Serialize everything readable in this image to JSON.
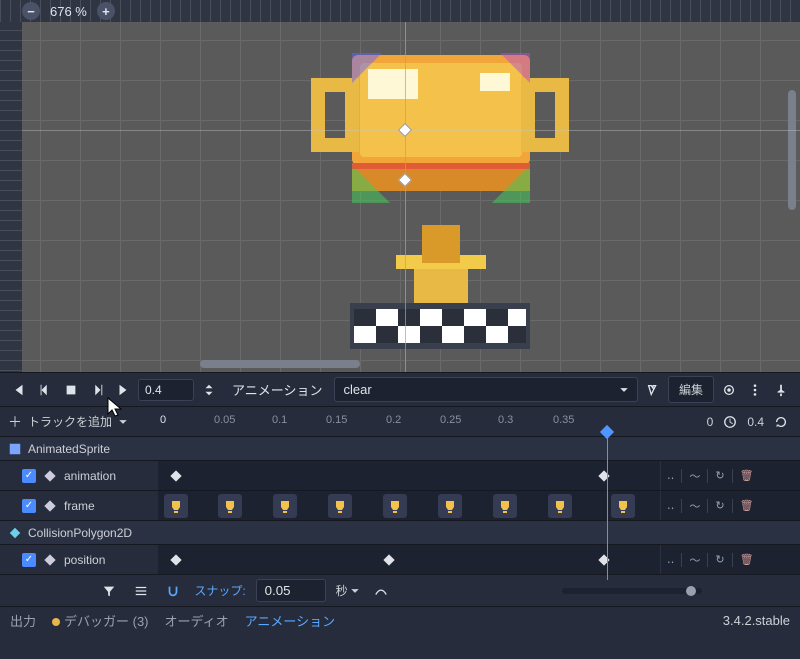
{
  "viewport": {
    "zoom_label": "676 %"
  },
  "playback": {
    "time_value": "0.4"
  },
  "toolbar": {
    "anim_label": "アニメーション",
    "anim_name": "clear",
    "edit_label": "編集"
  },
  "track_header": {
    "add_track": "トラックを追加",
    "ticks": [
      "0",
      "0.05",
      "0.1",
      "0.15",
      "0.2",
      "0.25",
      "0.3",
      "0.35"
    ],
    "start_time": "0",
    "length": "0.4"
  },
  "tracks": {
    "group1": "AnimatedSprite",
    "track1": "animation",
    "track2": "frame",
    "group2": "CollisionPolygon2D",
    "track3": "position",
    "ops_text": "‥"
  },
  "snap": {
    "label": "スナップ:",
    "value": "0.05",
    "unit": "秒"
  },
  "bottom": {
    "output": "出力",
    "debugger": "デバッガー (3)",
    "audio": "オーディオ",
    "animation": "アニメーション",
    "version": "3.4.2.stable"
  }
}
